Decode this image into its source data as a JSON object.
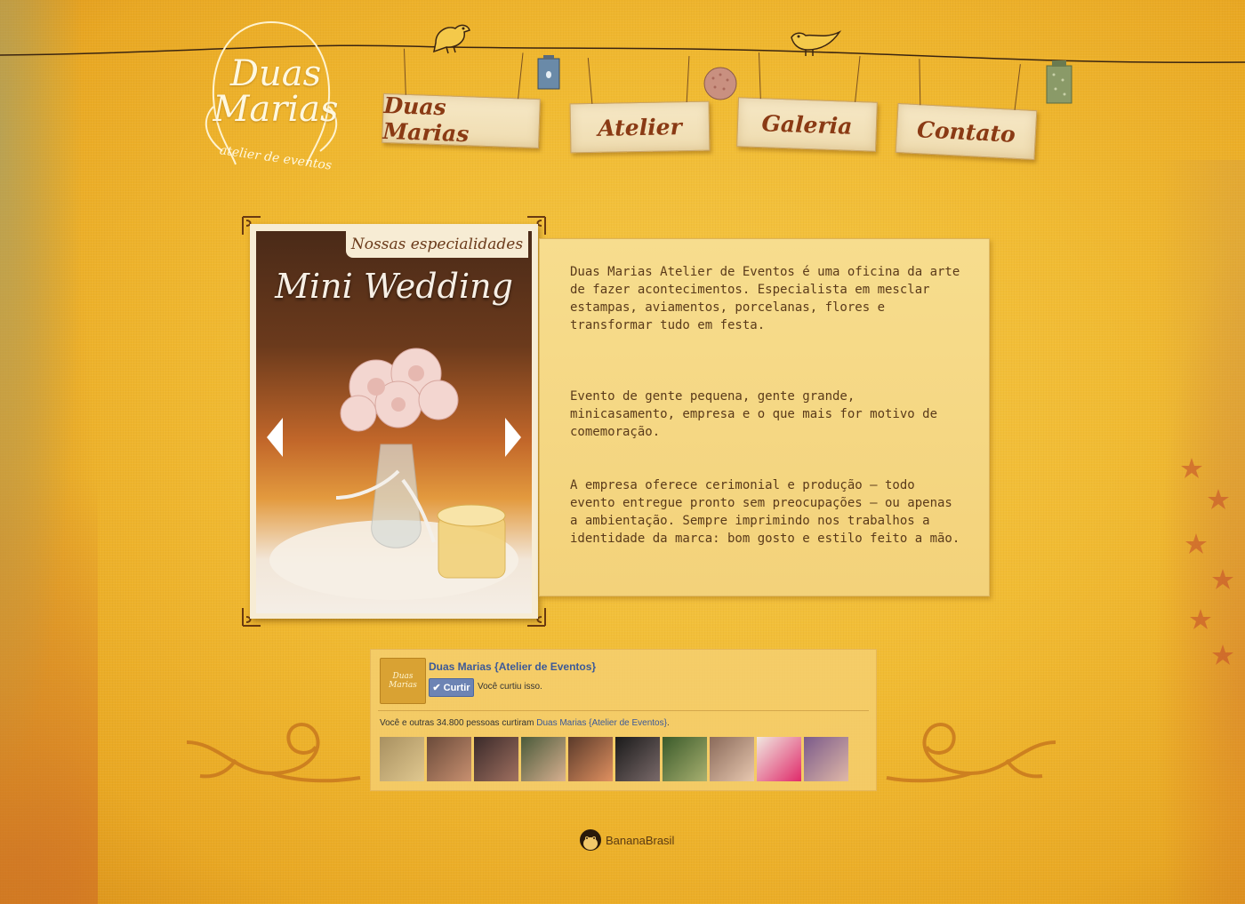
{
  "brand": {
    "title_line1": "Duas",
    "title_line2": "Marias",
    "subtitle": "atelier de eventos"
  },
  "nav": {
    "items": [
      {
        "label": "Duas Marias"
      },
      {
        "label": "Atelier"
      },
      {
        "label": "Galeria"
      },
      {
        "label": "Contato"
      }
    ]
  },
  "slider": {
    "badge": "Nossas especialidades",
    "heading": "Mini Wedding"
  },
  "about": {
    "p1": "Duas Marias Atelier de Eventos é uma oficina da arte de fazer acontecimentos. Especialista em mesclar estampas, aviamentos, porcelanas, flores e transformar tudo em festa.",
    "p2": "Evento de gente pequena, gente grande, minicasamento, empresa e o que mais for motivo de comemoração.",
    "p3": "A empresa oferece cerimonial e produção – todo evento entregue pronto sem preocupações – ou apenas a ambientação. Sempre imprimindo nos trabalhos a identidade da marca: bom gosto e estilo feito a mão."
  },
  "facebook": {
    "thumb_line1": "Duas",
    "thumb_line2": "Marias",
    "page_name": "Duas Marias {Atelier de Eventos}",
    "like_label": "Curtir",
    "liked_text": "Você curtiu isso.",
    "count_prefix": "Você e outras 34.800 pessoas curtiram ",
    "count_link": "Duas Marias {Atelier de Eventos}",
    "count_suffix": "."
  },
  "footer": {
    "credit": "BananaBrasil"
  },
  "colors": {
    "nav_text": "#8a3a14",
    "facebook_blue": "#3b5998",
    "body_text": "#5a3a1a"
  }
}
